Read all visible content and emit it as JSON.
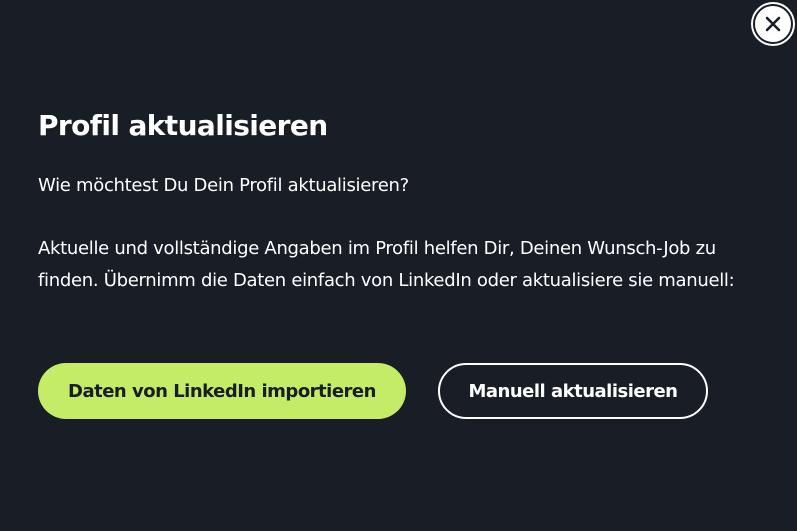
{
  "dialog": {
    "title": "Profil aktualisieren",
    "question": "Wie möchtest Du Dein Profil aktualisieren?",
    "description": "Aktuelle und vollständige Angaben im Profil helfen Dir, Deinen Wunsch-Job zu finden. Übernimm die Daten einfach von LinkedIn oder aktualisiere sie manuell:",
    "close_icon": "close-icon"
  },
  "actions": {
    "primary_label": "Daten von LinkedIn importieren",
    "secondary_label": "Manuell aktualisieren"
  },
  "colors": {
    "background": "#181d26",
    "accent": "#c4ec66",
    "text": "#ffffff"
  }
}
